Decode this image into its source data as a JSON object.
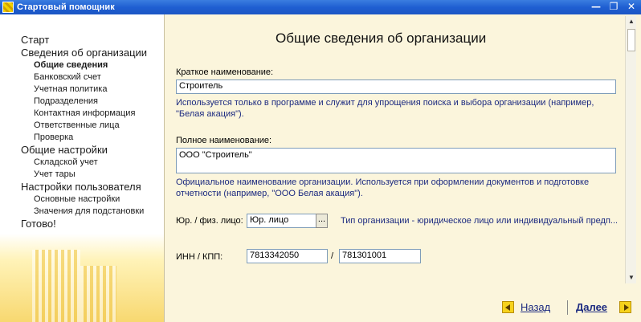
{
  "window": {
    "title": "Стартовый помощник",
    "minimize_glyph": "—",
    "restore_glyph": "❐",
    "close_glyph": "✕"
  },
  "sidebar": {
    "items": [
      {
        "label": "Старт",
        "level": "top"
      },
      {
        "label": "Сведения об организации",
        "level": "top"
      },
      {
        "label": "Общие сведения",
        "level": "sub",
        "active": true
      },
      {
        "label": "Банковский счет",
        "level": "sub"
      },
      {
        "label": "Учетная политика",
        "level": "sub"
      },
      {
        "label": "Подразделения",
        "level": "sub"
      },
      {
        "label": "Контактная информация",
        "level": "sub"
      },
      {
        "label": "Ответственные лица",
        "level": "sub"
      },
      {
        "label": "Проверка",
        "level": "sub"
      },
      {
        "label": "Общие настройки",
        "level": "top"
      },
      {
        "label": "Складской учет",
        "level": "sub"
      },
      {
        "label": "Учет тары",
        "level": "sub"
      },
      {
        "label": "Настройки пользователя",
        "level": "top"
      },
      {
        "label": "Основные настройки",
        "level": "sub"
      },
      {
        "label": "Значения для подстановки",
        "level": "sub"
      },
      {
        "label": "Готово!",
        "level": "top"
      }
    ]
  },
  "main": {
    "title": "Общие сведения об организации",
    "short_name": {
      "label": "Краткое наименование:",
      "value": "Строитель",
      "hint": "Используется только в программе и служит для упрощения поиска и выбора организации (например, \"Белая акация\")."
    },
    "full_name": {
      "label": "Полное наименование:",
      "value": "ООО \"Строитель\"",
      "hint": "Официальное наименование организации. Используется при оформлении документов и подготовке отчетности (например, \"ООО Белая акация\")."
    },
    "legal_type": {
      "label": "Юр. / физ. лицо:",
      "value": "Юр. лицо",
      "choose_glyph": "...",
      "description": "Тип организации - юридическое лицо или индивидуальный предп..."
    },
    "inn_kpp": {
      "label": "ИНН / КПП:",
      "inn": "7813342050",
      "separator": "/",
      "kpp": "781301001"
    }
  },
  "scrollbar": {
    "up_glyph": "▲",
    "down_glyph": "▼"
  },
  "footer": {
    "back_label": "Назад",
    "next_label": "Далее"
  },
  "colors": {
    "titlebar": "#1f5fd2",
    "content_bg": "#fbf5dc",
    "hint_text": "#1c2a80",
    "nav_arrow": "#f6d21c"
  }
}
